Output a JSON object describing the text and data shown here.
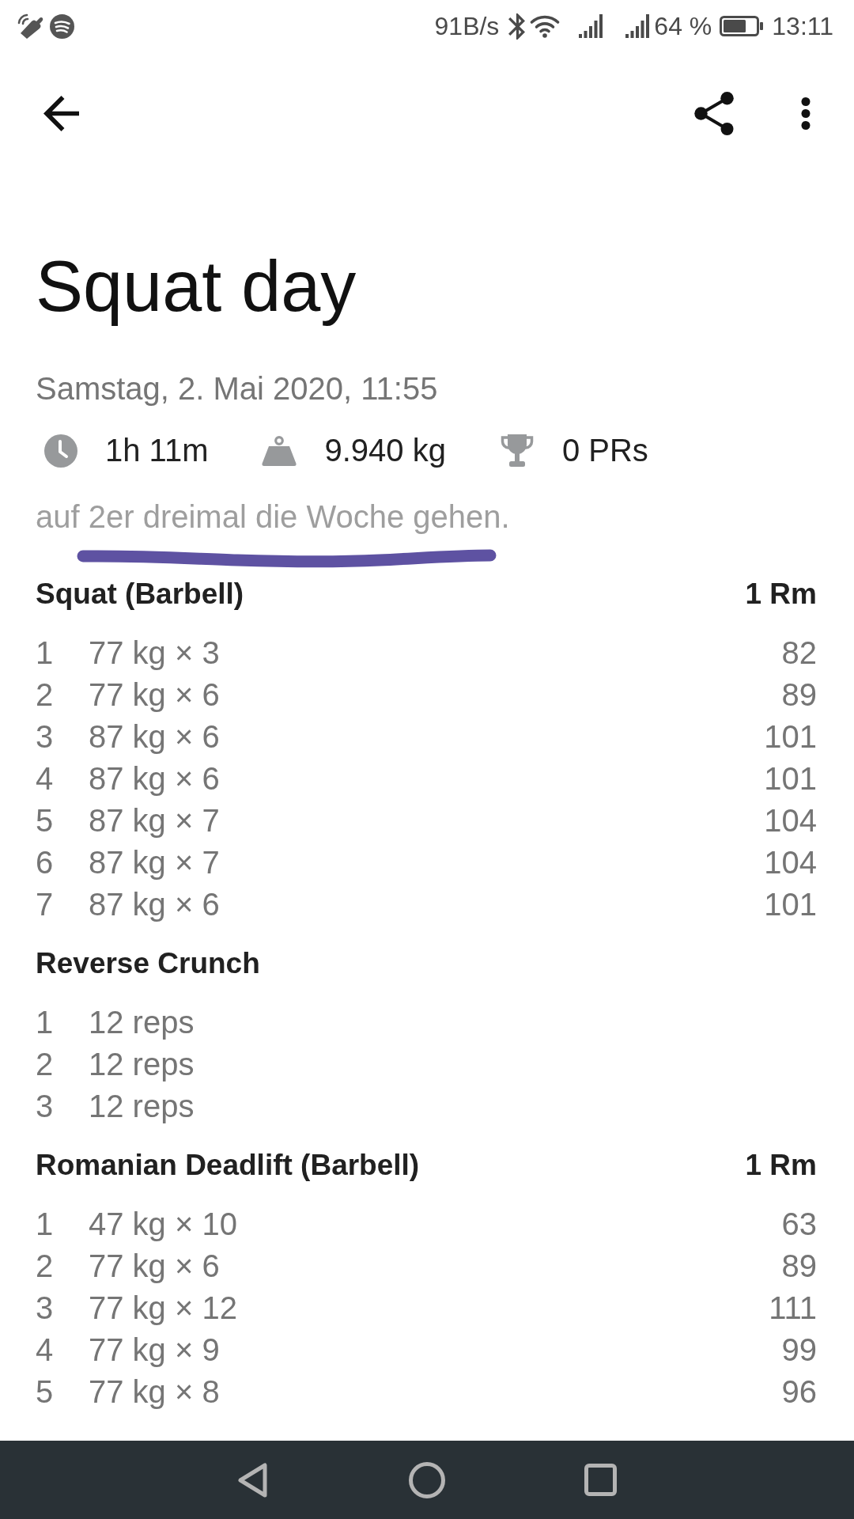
{
  "status_bar": {
    "network_speed": "91B/s",
    "battery": "64 %",
    "time": "13:11"
  },
  "workout": {
    "title": "Squat day",
    "date": "Samstag, 2. Mai 2020, 11:55",
    "stats": [
      {
        "kind": "duration",
        "value": "1h 11m"
      },
      {
        "kind": "volume",
        "value": "9.940 kg"
      },
      {
        "kind": "prs",
        "value": "0 PRs"
      }
    ],
    "note": "auf 2er dreimal die Woche gehen."
  },
  "exercises": [
    {
      "name": "Squat (Barbell)",
      "column": "1 Rm",
      "sets": [
        {
          "number": "1",
          "performance": "77 kg × 3",
          "one_rm": "82"
        },
        {
          "number": "2",
          "performance": "77 kg × 6",
          "one_rm": "89"
        },
        {
          "number": "3",
          "performance": "87 kg × 6",
          "one_rm": "101"
        },
        {
          "number": "4",
          "performance": "87 kg × 6",
          "one_rm": "101"
        },
        {
          "number": "5",
          "performance": "87 kg × 7",
          "one_rm": "104"
        },
        {
          "number": "6",
          "performance": "87 kg × 7",
          "one_rm": "104"
        },
        {
          "number": "7",
          "performance": "87 kg × 6",
          "one_rm": "101"
        }
      ]
    },
    {
      "name": "Reverse Crunch",
      "sets": [
        {
          "number": "1",
          "performance": "12 reps"
        },
        {
          "number": "2",
          "performance": "12 reps"
        },
        {
          "number": "3",
          "performance": "12 reps"
        }
      ]
    },
    {
      "name": "Romanian Deadlift (Barbell)",
      "column": "1 Rm",
      "sets": [
        {
          "number": "1",
          "performance": "47 kg × 10",
          "one_rm": "63"
        },
        {
          "number": "2",
          "performance": "77 kg × 6",
          "one_rm": "89"
        },
        {
          "number": "3",
          "performance": "77 kg × 12",
          "one_rm": "111"
        },
        {
          "number": "4",
          "performance": "77 kg × 9",
          "one_rm": "99"
        },
        {
          "number": "5",
          "performance": "77 kg × 8",
          "one_rm": "96"
        }
      ]
    }
  ]
}
